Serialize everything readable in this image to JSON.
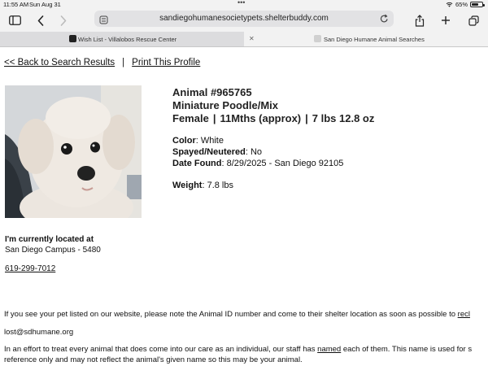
{
  "status_bar": {
    "time": "11:55 AM",
    "date": "Sun Aug 31",
    "dots": "•••",
    "battery_text": "65%",
    "battery_level": 0.65,
    "icons": [
      "wifi-icon",
      "battery-icon"
    ]
  },
  "toolbar": {
    "url": "sandiegohumanesocietypets.shelterbuddy.com",
    "icons": [
      "sidebar-icon",
      "back-icon",
      "forward-icon",
      "page-settings-icon",
      "reload-icon",
      "share-icon",
      "new-tab-icon",
      "tabs-overview-icon"
    ]
  },
  "tabs": [
    {
      "title": "Wish List - Villalobos Rescue Center",
      "active": false
    },
    {
      "title": "San Diego Humane Animal Searches",
      "active": true
    }
  ],
  "page": {
    "back_link": "<< Back to Search Results",
    "separator": "|",
    "print_link": "Print This Profile",
    "animal": {
      "id_line": "Animal #965765",
      "breed": "Miniature Poodle/Mix",
      "sex": "Female",
      "age": "11Mths (approx)",
      "weight_summary": "7 lbs 12.8 oz",
      "color_label": "Color",
      "color_value": ": White",
      "spayed_label": "Spayed/Neutered",
      "spayed_value": ": No",
      "date_found_label": "Date Found",
      "date_found_value": ": 8/29/2025 - San Diego 92105",
      "weight_label": "Weight",
      "weight_value": ": 7.8 lbs"
    },
    "location_heading": "I'm currently located at",
    "location": "San Diego Campus - 5480",
    "phone": "619-299-7012",
    "notice_text": "If you see your pet listed on our website, please note the Animal ID number and come to their shelter location as soon as possible to ",
    "notice_link": "recl",
    "email": "lost@sdhumane.org",
    "effort_line1_a": "In an effort to treat every animal that does come into our care as an individual, our staff has ",
    "effort_line1_link": "named",
    "effort_line1_b": " each of them. This name is used for s",
    "effort_line2": "reference only and may not reflect the animal's given name so this may be your animal."
  }
}
